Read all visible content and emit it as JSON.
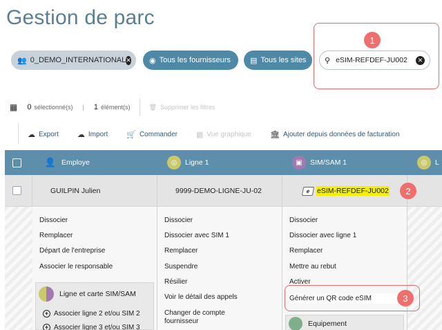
{
  "page": {
    "title": "Gestion de parc"
  },
  "filters": {
    "org": {
      "label": "0_DEMO_INTERNATIONAL",
      "icon": "people-icon"
    },
    "fournisseurs": {
      "label": "Tous les fournisseurs",
      "icon": "broadcast-icon"
    },
    "sites": {
      "label": "Tous les sites",
      "icon": "building-icon"
    },
    "search": {
      "value": "eSIM-REFDEF-JU002",
      "icon": "search-icon"
    }
  },
  "selection": {
    "selected_count": "0",
    "selected_label": "sélectionné(s)",
    "separator": "|",
    "element_count": "1",
    "element_label": "élément(s)",
    "clear_filters": "Supprimer les filtres"
  },
  "toolbar": {
    "export": "Export",
    "import": "Import",
    "commander": "Commander",
    "vue_graphique": "Vue graphique",
    "ajouter": "Ajouter depuis données de facturation"
  },
  "table": {
    "columns": [
      "Employe",
      "Ligne 1",
      "SIM/SAM 1",
      "L"
    ],
    "row": {
      "employe": "GUILPIN Julien",
      "ligne": "9999-DEMO-LIGNE-JU-02",
      "sim_type": "e",
      "sim": "eSIM-REFDEF-JU002"
    }
  },
  "menus": {
    "employe": {
      "items": [
        "Dissocier",
        "Remplacer",
        "Départ de l'entreprise",
        "Associer le responsable"
      ],
      "sub_title": "Ligne et carte SIM/SAM",
      "sub_items": [
        "Associer ligne 2 et/ou SIM 2",
        "Associer ligne 3 et/ou SIM 3"
      ]
    },
    "ligne": {
      "items": [
        "Dissocier",
        "Dissocier avec SIM 1",
        "Remplacer",
        "Suspendre",
        "Résilier",
        "Voir le détail des appels",
        "Changer de compte fournisseur"
      ]
    },
    "sim": {
      "items": [
        "Dissocier",
        "Dissocier avec ligne 1",
        "Remplacer",
        "Mettre au rebut",
        "Activer",
        "Générer un QR code eSIM"
      ],
      "sub_title": "Equipement"
    }
  },
  "callouts": [
    "1",
    "2",
    "3"
  ],
  "colors": {
    "header": "#5d8fac",
    "chip": "#4e8aa8",
    "callout": "#ef6e6e",
    "highlight": "#f4f000"
  }
}
